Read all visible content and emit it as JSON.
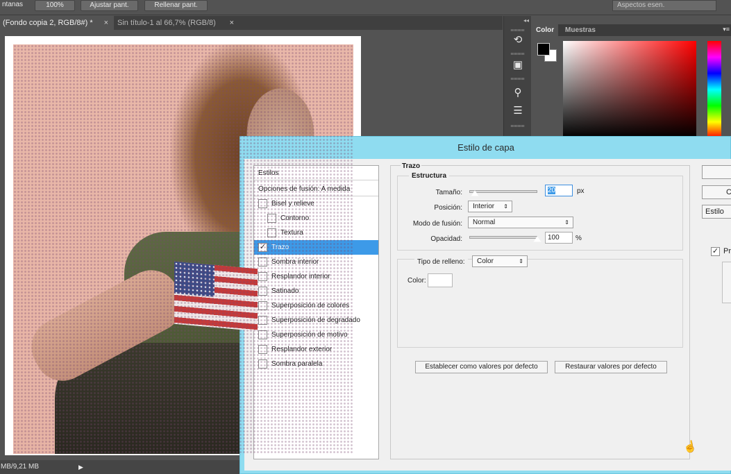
{
  "optionbar": {
    "ventanas": "ntanas",
    "zoom": "100%",
    "ajustar": "Ajustar pant.",
    "rellenar": "Rellenar pant.",
    "workspace": "Aspectos esen."
  },
  "tabs": [
    {
      "label": "(Fondo copia 2, RGB/8#) *",
      "active": true
    },
    {
      "label": "Sin título-1 al 66,7% (RGB/8)",
      "active": false
    }
  ],
  "tab_close_symbol": "×",
  "statusbar": {
    "doc_size": "MB/9,21 MB",
    "arrow": "▶"
  },
  "toolstrip": {
    "collapse": "◂◂",
    "icons": [
      "history-icon",
      "brush-presets-icon",
      "brushes-icon",
      "adjustments-icon"
    ]
  },
  "colorpanel": {
    "tabs": [
      "Color",
      "Muestras"
    ],
    "menu": "▾≡",
    "foreground": "#000000",
    "background": "#ffffff"
  },
  "dialog": {
    "title": "Estilo de capa",
    "styles_header": "Estilos",
    "blend_options": "Opciones de fusión: A medida",
    "styles": [
      {
        "label": "Bisel y relieve",
        "checked": false,
        "sub": false,
        "selected": false
      },
      {
        "label": "Contorno",
        "checked": false,
        "sub": true,
        "selected": false
      },
      {
        "label": "Textura",
        "checked": false,
        "sub": true,
        "selected": false
      },
      {
        "label": "Trazo",
        "checked": true,
        "sub": false,
        "selected": true
      },
      {
        "label": "Sombra interior",
        "checked": false,
        "sub": false,
        "selected": false
      },
      {
        "label": "Resplandor interior",
        "checked": false,
        "sub": false,
        "selected": false
      },
      {
        "label": "Satinado",
        "checked": false,
        "sub": false,
        "selected": false
      },
      {
        "label": "Superposición de colores",
        "checked": false,
        "sub": false,
        "selected": false
      },
      {
        "label": "Superposición de degradado",
        "checked": false,
        "sub": false,
        "selected": false
      },
      {
        "label": "Superposición de motivo",
        "checked": false,
        "sub": false,
        "selected": false
      },
      {
        "label": "Resplandor exterior",
        "checked": false,
        "sub": false,
        "selected": false
      },
      {
        "label": "Sombra paralela",
        "checked": false,
        "sub": false,
        "selected": false
      }
    ],
    "section_title": "Trazo",
    "structure_title": "Estructura",
    "size_label": "Tamaño:",
    "size_value": "20",
    "size_unit": "px",
    "size_slider": 0.08,
    "position_label": "Posición:",
    "position_value": "Interior",
    "blend_mode_label": "Modo de fusión:",
    "blend_mode_value": "Normal",
    "opacity_label": "Opacidad:",
    "opacity_value": "100",
    "opacity_unit": "%",
    "opacity_slider": 1.0,
    "fill_type_label": "Tipo de relleno:",
    "fill_type_value": "Color",
    "color_label": "Color:",
    "stroke_color": "#ffffff",
    "set_default": "Establecer como valores por defecto",
    "reset_default": "Restaurar valores por defecto",
    "right_buttons": [
      "",
      "C",
      "Estilo"
    ],
    "preview_label": "Pre",
    "preview_checked": true,
    "check_symbol": "✓",
    "arrow_symbol": "⇕"
  }
}
